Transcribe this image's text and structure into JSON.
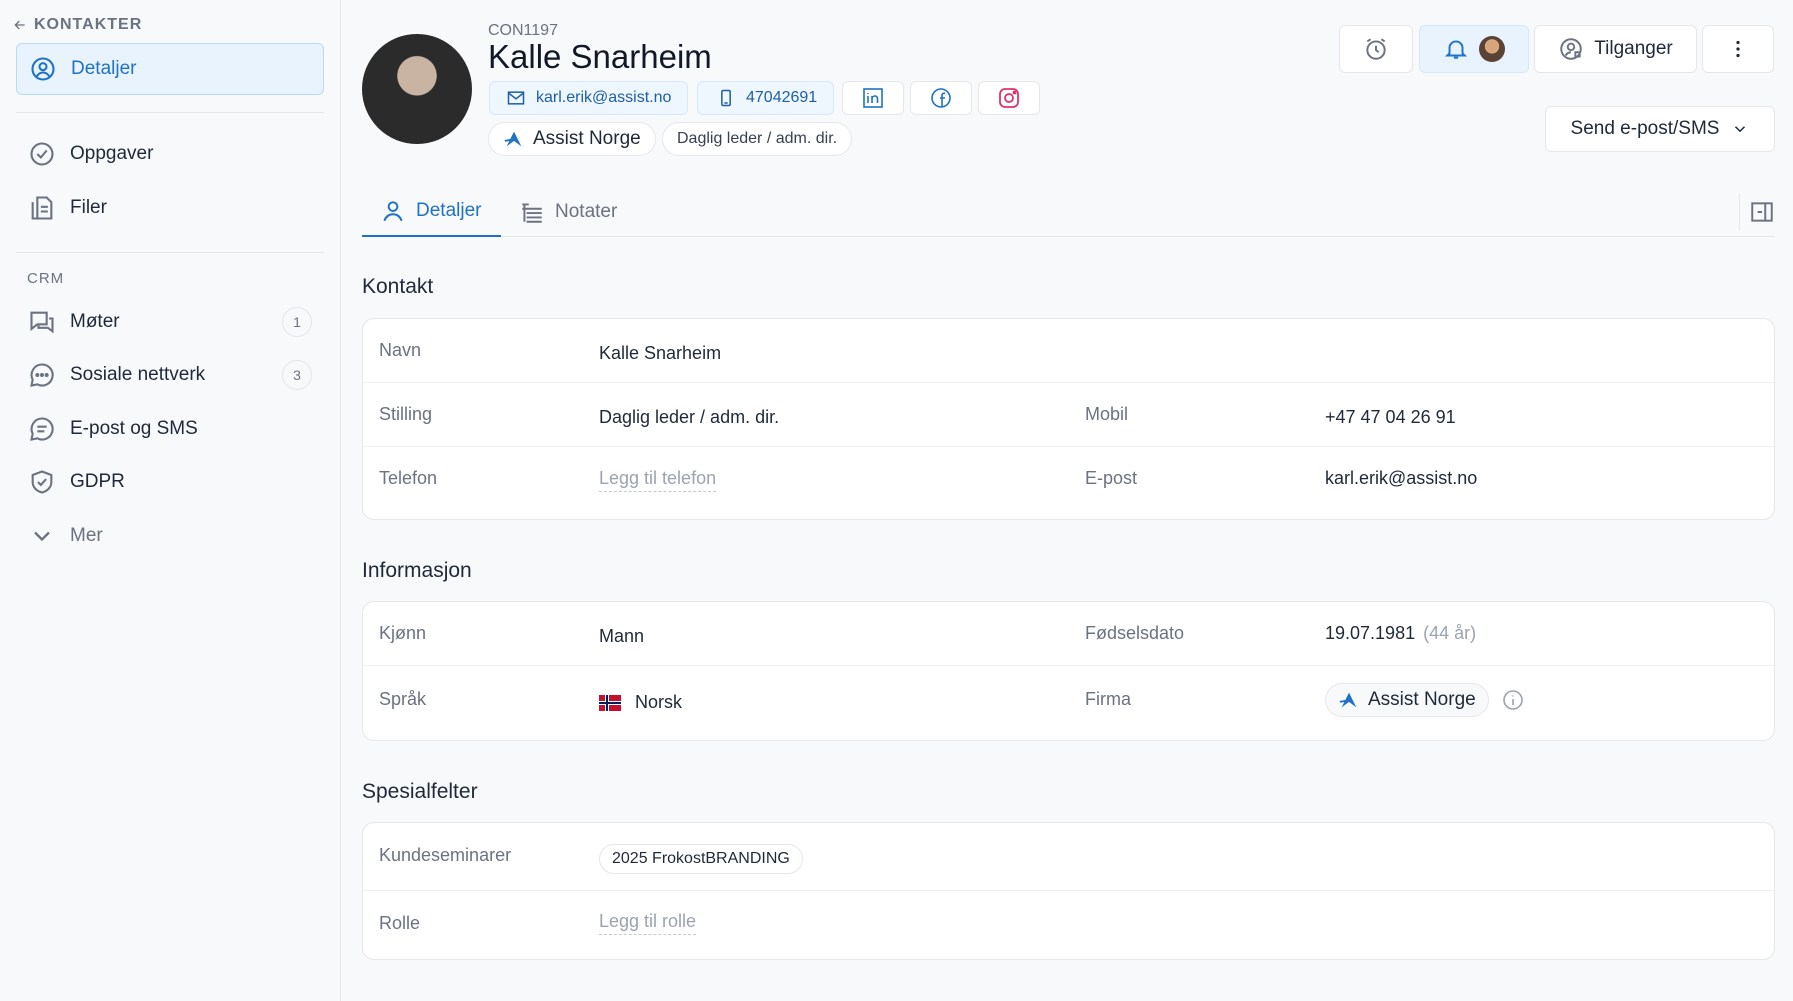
{
  "sidebar": {
    "back_label": "KONTAKTER",
    "active_item": "Detaljer",
    "items": [
      "Oppgaver",
      "Filer"
    ],
    "crm_label": "CRM",
    "crm_items": [
      {
        "label": "Møter",
        "count": "1"
      },
      {
        "label": "Sosiale nettverk",
        "count": "3"
      },
      {
        "label": "E-post og SMS"
      },
      {
        "label": "GDPR"
      }
    ],
    "more_label": "Mer"
  },
  "header": {
    "contact_id": "CON1197",
    "name": "Kalle Snarheim",
    "email": "karl.erik@assist.no",
    "phone": "47042691",
    "company": "Assist Norge",
    "title": "Daglig leder / adm. dir.",
    "permissions_label": "Tilganger",
    "send_label": "Send e-post/SMS"
  },
  "tabs": [
    {
      "label": "Detaljer"
    },
    {
      "label": "Notater"
    }
  ],
  "sections": {
    "contact": {
      "title": "Kontakt",
      "name_label": "Navn",
      "name_value": "Kalle Snarheim",
      "position_label": "Stilling",
      "position_value": "Daglig leder / adm. dir.",
      "mobile_label": "Mobil",
      "mobile_value": "+47 47 04 26 91",
      "phone_label": "Telefon",
      "phone_placeholder": "Legg til telefon",
      "email_label": "E-post",
      "email_value": "karl.erik@assist.no"
    },
    "info": {
      "title": "Informasjon",
      "gender_label": "Kjønn",
      "gender_value": "Mann",
      "birth_label": "Fødselsdato",
      "birth_value": "19.07.1981",
      "age_value": "(44 år)",
      "language_label": "Språk",
      "language_value": "Norsk",
      "firm_label": "Firma",
      "firm_value": "Assist Norge"
    },
    "custom": {
      "title": "Spesialfelter",
      "seminar_label": "Kundeseminarer",
      "seminar_value": "2025 FrokostBRANDING",
      "role_label": "Rolle",
      "role_placeholder": "Legg til rolle"
    }
  },
  "colors": {
    "accent": "#1e72c8",
    "active_bg": "#e8f3fd",
    "muted": "#6b7280"
  },
  "icons": [
    "arrow-left-icon",
    "user-circle-icon",
    "check-circle-icon",
    "file-icon",
    "chat-icon",
    "dots-chat-icon",
    "message-icon",
    "shield-icon",
    "chevron-down-icon",
    "alarm-icon",
    "bell-icon",
    "users-lock-icon",
    "kebab-icon",
    "mail-icon",
    "phone-icon",
    "linkedin-icon",
    "facebook-icon",
    "instagram-icon",
    "company-logo-icon",
    "user-icon",
    "notes-icon",
    "side-panel-icon",
    "info-icon"
  ]
}
